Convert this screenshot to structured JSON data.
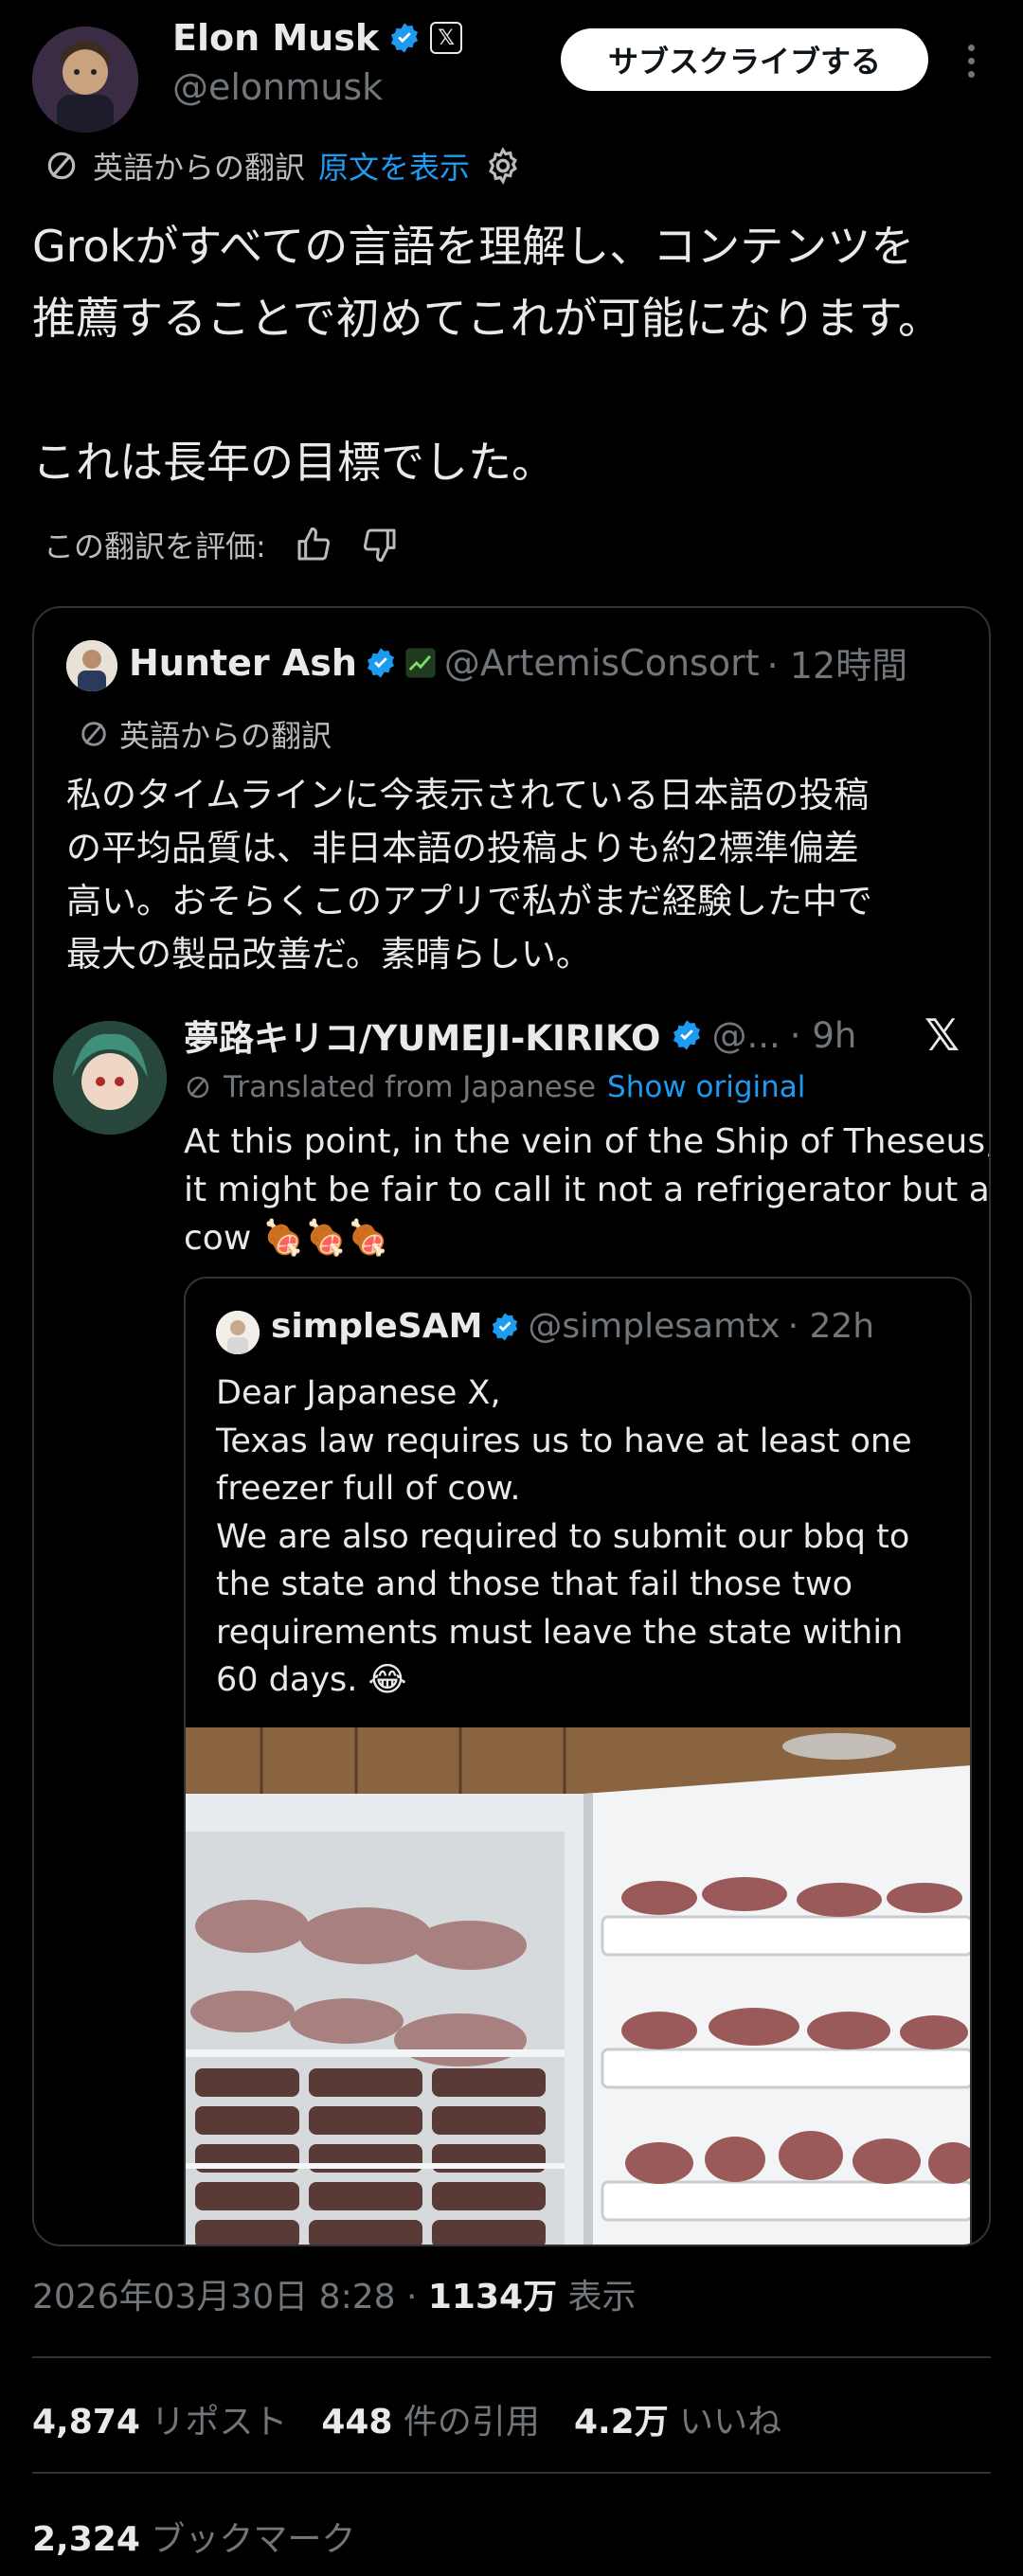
{
  "colors": {
    "accent": "#1d9bf0",
    "background": "#000000",
    "text": "#e7e9ea",
    "muted": "#71767b",
    "border": "#2f3336"
  },
  "header": {
    "name": "Elon Musk",
    "handle": "@elonmusk",
    "subscribe_label": "サブスクライブする",
    "x_badge": "𝕏"
  },
  "translation": {
    "label": "英語からの翻訳",
    "show_original": "原文を表示"
  },
  "main_text": "Grokがすべての言語を理解し、コンテンツを\n推薦することで初めてこれが可能になります。\n\nこれは長年の目標でした。",
  "rate": {
    "label": "この翻訳を評価:"
  },
  "quote": {
    "name": "Hunter Ash",
    "handle": "@ArtemisConsort",
    "time": "· 12時間",
    "translation_label": "英語からの翻訳",
    "text": "私のタイムラインに今表示されている日本語の投稿\nの平均品質は、非日本語の投稿よりも約2標準偏差\n高い。おそらくこのアプリで私がまだ経験した中で\n最大の製品改善だ。素晴らしい。",
    "nested": {
      "name": "夢路キリコ/YUMEJI-KIRIKO",
      "handle": "@...",
      "time": "· 9h",
      "x_mark": "𝕏",
      "translation_label": "Translated from Japanese",
      "show_original": "Show original",
      "text": "At this point, in the vein of the Ship of Theseus,\nit might be fair to call it not a refrigerator but a\ncow 🍖🍖🍖",
      "inner": {
        "name": "simpleSAM",
        "handle": "@simplesamtx",
        "time": "· 22h",
        "text": "Dear Japanese X,\nTexas law requires us to have at least one\nfreezer full of cow.\nWe are also required to submit our bbq to\nthe state and those that fail those two\nrequirements must leave the state within\n60 days. 😂"
      }
    }
  },
  "meta": {
    "datetime": "2026年03月30日 8:28 · ",
    "views": "1134万",
    "views_label": " 表示"
  },
  "stats": {
    "reposts": "4,874",
    "reposts_label": " リポスト",
    "quotes": "448",
    "quotes_label": " 件の引用",
    "likes": "4.2万",
    "likes_label": " いいね",
    "bookmarks": "2,324",
    "bookmarks_label": " ブックマーク"
  }
}
